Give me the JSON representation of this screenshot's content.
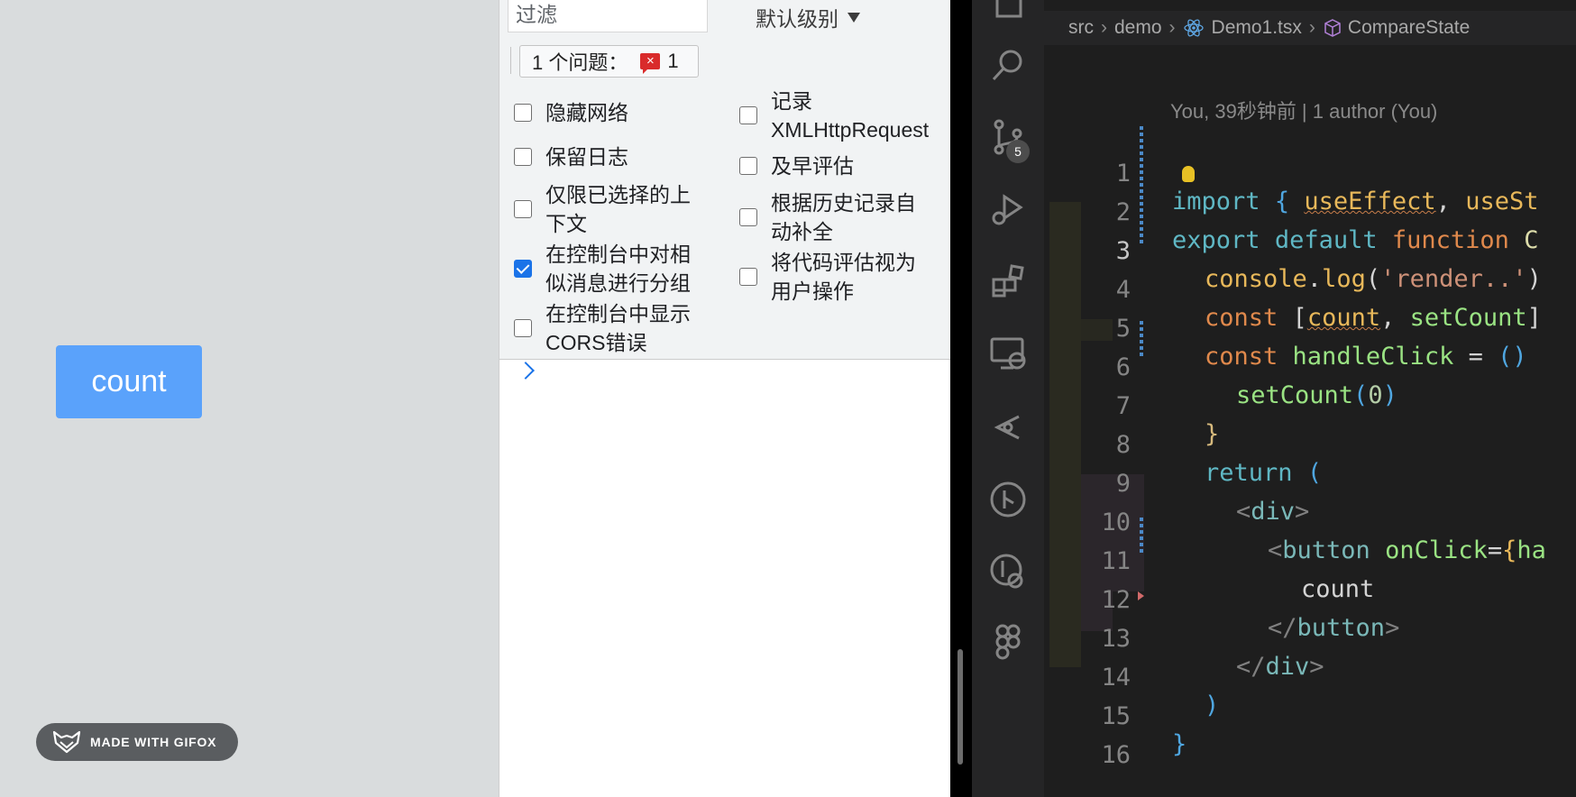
{
  "preview": {
    "count_button": "count",
    "badge": "MADE WITH GIFOX"
  },
  "devtools": {
    "filter_placeholder": "过滤",
    "level_select": "默认级别",
    "issues_label": "1 个问题：",
    "issues_icon": "×",
    "issues_count": "1",
    "settings": [
      {
        "label": "隐藏网络",
        "checked": false
      },
      {
        "label": "记录\nXMLHttpRequest",
        "checked": false
      },
      {
        "label": "保留日志",
        "checked": false
      },
      {
        "label": "及早评估",
        "checked": false
      },
      {
        "label": "仅限已选择的上\n下文",
        "checked": false
      },
      {
        "label": "根据历史记录自\n动补全",
        "checked": false
      },
      {
        "label": "在控制台中对相\n似消息进行分组",
        "checked": true
      },
      {
        "label": "将代码评估视为\n用户操作",
        "checked": false
      },
      {
        "label": "在控制台中显示\nCORS错误",
        "checked": false
      }
    ]
  },
  "vscode": {
    "scm_badge": "5",
    "breadcrumb": {
      "src": "src",
      "demo": "demo",
      "file": "Demo1.tsx",
      "symbol": "CompareState"
    },
    "blame": "You, 39秒钟前 | 1 author (You)",
    "line_numbers": [
      "1",
      "2",
      "3",
      "4",
      "5",
      "6",
      "7",
      "8",
      "9",
      "10",
      "11",
      "12",
      "13",
      "14",
      "15",
      "16"
    ],
    "code": {
      "l1_import": "import",
      "l1_brace": "{",
      "l1_useEffect": "useEffect",
      "l1_comma": ",",
      "l1_useState": "useSt",
      "l2_ex": "ex",
      "l2_port": "port",
      "l2_default": "default",
      "l2_function": "function",
      "l2_name": "C",
      "l3_console": "console",
      "l3_dot": ".",
      "l3_log": "log",
      "l3_open": "(",
      "l3_str": "'render..'",
      "l3_close": ")",
      "l4_const": "const",
      "l4_open": "[",
      "l4_count": "count",
      "l4_comma": ",",
      "l4_setCount": "setCount",
      "l4_close": "]",
      "l5_const": "const",
      "l5_handle": "handleClick",
      "l5_eq": "=",
      "l5_parens": "()",
      "l6_setCount": "setCount",
      "l6_open": "(",
      "l6_zero": "0",
      "l6_close": ")",
      "l7_close": "}",
      "l8_return": "return",
      "l8_paren": "(",
      "l9_lt": "<",
      "l9_div": "div",
      "l9_gt": ">",
      "l10_lt": "<",
      "l10_button": "button",
      "l10_onClick": "onClick",
      "l10_eq": "=",
      "l10_brace": "{",
      "l10_ha": "ha",
      "l11_text": "count",
      "l12_lt": "</",
      "l12_button": "button",
      "l12_gt": ">",
      "l13_lt": "</",
      "l13_div": "div",
      "l13_gt": ">",
      "l14_paren": ")",
      "l15_brace": "}"
    }
  }
}
